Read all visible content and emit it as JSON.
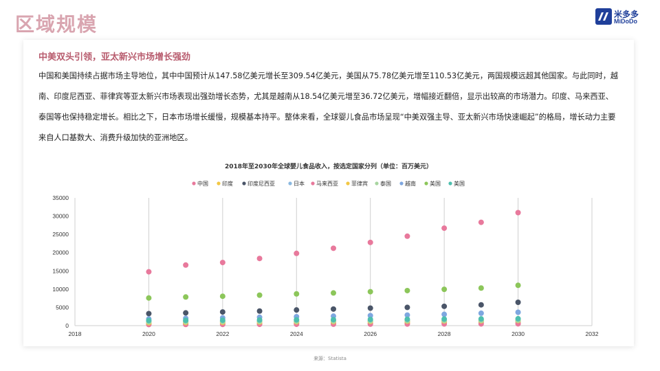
{
  "page": {
    "title": "区域规模",
    "logo_cn": "米多多",
    "logo_en": "MiDoDo",
    "headline": "中美双头引领，亚太新兴市场增长强劲",
    "body": "中国和美国持续占据市场主导地位，其中中国预计从147.58亿美元增长至309.54亿美元，美国从75.78亿美元增至110.53亿美元，两国规模远超其他国家。与此同时，越南、印度尼西亚、菲律宾等亚太新兴市场表现出强劲增长态势，尤其是越南从18.54亿美元增至36.72亿美元，增幅接近翻倍，显示出较高的市场潜力。印度、马来西亚、泰国等也保持稳定增长。相比之下，日本市场增长缓慢，规模基本持平。整体来看，全球婴儿食品市场呈现“中美双强主导、亚太新兴市场快速崛起”的格局，增长动力主要来自人口基数大、消费升级加快的亚洲地区。",
    "source": "来源：Statista",
    "brand_color": "#1f3f9a"
  },
  "chart_data": {
    "type": "scatter",
    "title": "2018年至2030年全球婴儿食品收入，按选定国家分列（单位：百万美元）",
    "xlabel": "",
    "ylabel": "",
    "xlim": [
      2018,
      2032
    ],
    "ylim": [
      0,
      35000
    ],
    "x_ticks": [
      2018,
      2020,
      2022,
      2024,
      2026,
      2028,
      2030,
      2032
    ],
    "y_ticks": [
      0,
      5000,
      10000,
      15000,
      20000,
      25000,
      30000,
      35000
    ],
    "grid": "vertical",
    "legend_position": "top",
    "x": [
      2020,
      2021,
      2022,
      2023,
      2024,
      2025,
      2026,
      2027,
      2028,
      2029,
      2030
    ],
    "series": [
      {
        "name": "中国",
        "color": "#e8799c",
        "values": [
          14758,
          16600,
          17300,
          18400,
          19800,
          21200,
          22800,
          24500,
          26700,
          28300,
          30954
        ]
      },
      {
        "name": "印度",
        "color": "#f2c744",
        "values": [
          500,
          540,
          580,
          620,
          660,
          700,
          740,
          780,
          820,
          860,
          900
        ]
      },
      {
        "name": "印度尼西亚",
        "color": "#4a5568",
        "values": [
          3300,
          3500,
          3750,
          4000,
          4300,
          4550,
          4800,
          5000,
          5300,
          5700,
          6400
        ]
      },
      {
        "name": "日本",
        "color": "#8ab8e0",
        "values": [
          1200,
          1200,
          1210,
          1210,
          1220,
          1220,
          1230,
          1230,
          1240,
          1240,
          1250
        ]
      },
      {
        "name": "马来西亚",
        "color": "#e8799c",
        "values": [
          300,
          320,
          340,
          360,
          380,
          400,
          420,
          440,
          460,
          480,
          500
        ]
      },
      {
        "name": "菲律宾",
        "color": "#f2c744",
        "values": [
          800,
          860,
          920,
          980,
          1040,
          1100,
          1160,
          1220,
          1280,
          1340,
          1400
        ]
      },
      {
        "name": "泰国",
        "color": "#a8d5a0",
        "values": [
          1000,
          1050,
          1100,
          1150,
          1200,
          1250,
          1300,
          1350,
          1400,
          1450,
          1500
        ]
      },
      {
        "name": "越南",
        "color": "#7ea7e0",
        "values": [
          1854,
          2000,
          2150,
          2300,
          2450,
          2600,
          2750,
          2900,
          3100,
          3400,
          3672
        ]
      },
      {
        "name": "美国",
        "color": "#8cc65a",
        "values": [
          7578,
          7850,
          8050,
          8350,
          8700,
          8950,
          9300,
          9600,
          9950,
          10300,
          11053
        ]
      },
      {
        "name": "美国",
        "color": "#4dbfae",
        "values": [
          1400,
          1450,
          1500,
          1550,
          1600,
          1650,
          1700,
          1750,
          1800,
          1850,
          1900
        ]
      }
    ]
  }
}
